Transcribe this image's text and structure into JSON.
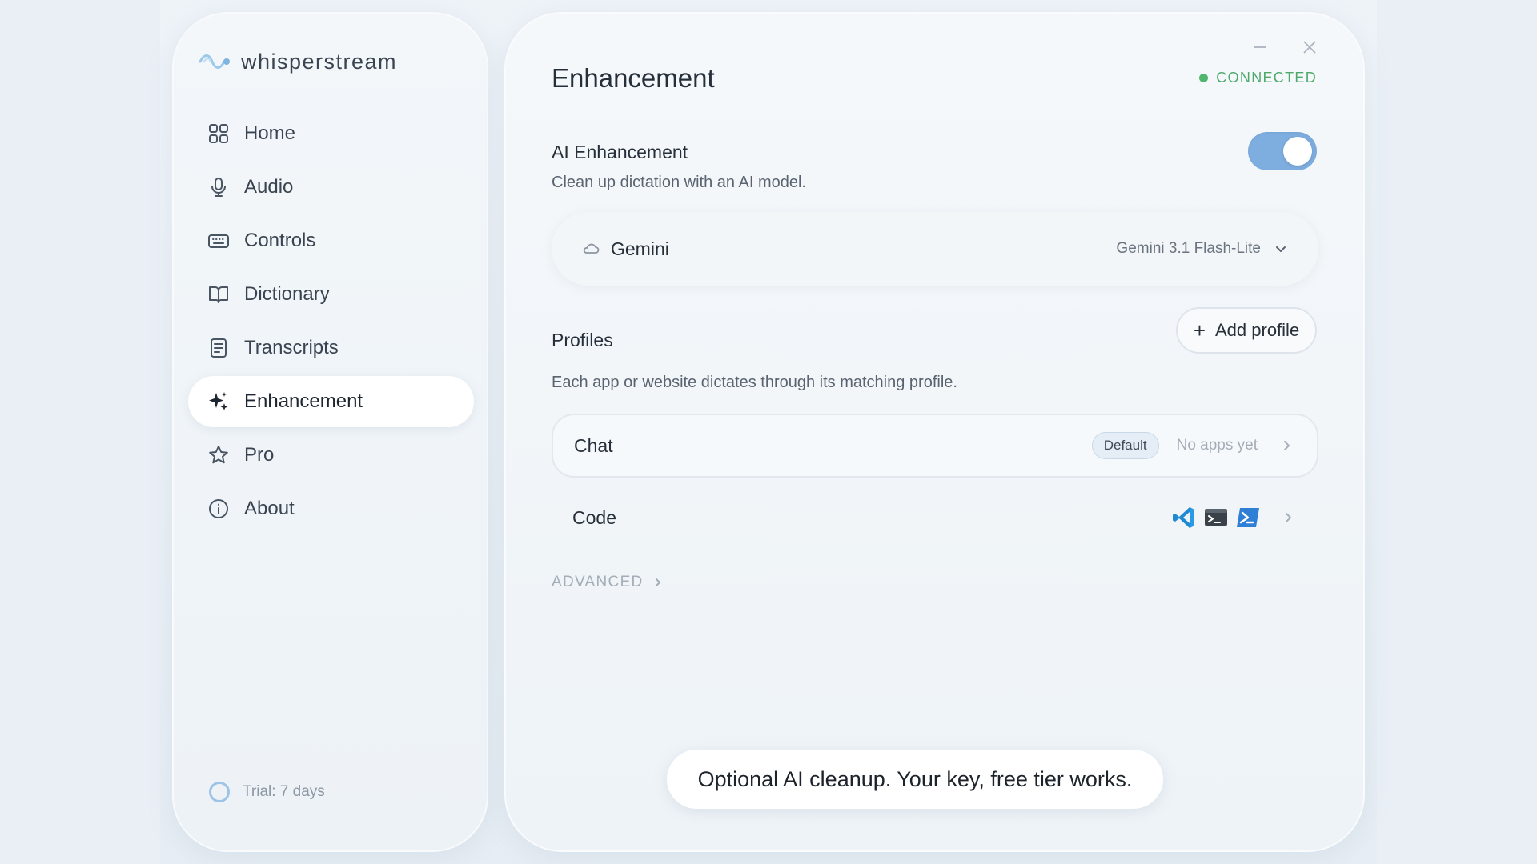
{
  "app": {
    "name": "whisperstream"
  },
  "sidebar": {
    "items": [
      {
        "label": "Home",
        "icon": "grid-icon"
      },
      {
        "label": "Audio",
        "icon": "microphone-icon"
      },
      {
        "label": "Controls",
        "icon": "keyboard-icon"
      },
      {
        "label": "Dictionary",
        "icon": "book-icon"
      },
      {
        "label": "Transcripts",
        "icon": "document-icon"
      },
      {
        "label": "Enhancement",
        "icon": "sparkle-icon",
        "active": true
      },
      {
        "label": "Pro",
        "icon": "star-icon"
      },
      {
        "label": "About",
        "icon": "info-icon"
      }
    ],
    "trial_text": "Trial: 7 days"
  },
  "main": {
    "title": "Enhancement",
    "status": "CONNECTED",
    "status_color": "#4ea96b",
    "ai_enhancement": {
      "title": "AI Enhancement",
      "description": "Clean up dictation with an AI model.",
      "enabled": true
    },
    "provider": {
      "name": "Gemini",
      "icon": "cloud-icon",
      "model": "Gemini 3.1 Flash-Lite"
    },
    "profiles": {
      "title": "Profiles",
      "add_label": "Add profile",
      "description": "Each app or website dictates through its matching profile.",
      "rows": [
        {
          "name": "Chat",
          "badge": "Default",
          "apps_text": "No apps yet"
        },
        {
          "name": "Code",
          "app_icons": [
            "vscode-icon",
            "terminal-icon",
            "powershell-icon"
          ]
        }
      ]
    },
    "advanced_label": "ADVANCED"
  },
  "caption": "Optional AI cleanup. Your key, free tier works.",
  "colors": {
    "accent": "#7eaee0",
    "connected": "#4fb56f"
  }
}
